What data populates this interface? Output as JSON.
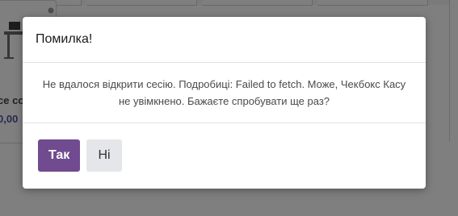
{
  "background": {
    "product_card": {
      "name_fragment": "ce co",
      "price_fragment": "0,00"
    }
  },
  "dialog": {
    "title": "Помилка!",
    "message": "Не вдалося відкрити сесію. Подробиці: Failed to fetch. Може, Чекбокс Касу не увімкнено. Бажаєте спробувати ще раз?",
    "buttons": {
      "confirm_label": "Так",
      "cancel_label": "Ні"
    }
  },
  "colors": {
    "primary_button": "#714b8f",
    "secondary_button": "#e4e6ea",
    "price_text": "#4a55a2"
  }
}
